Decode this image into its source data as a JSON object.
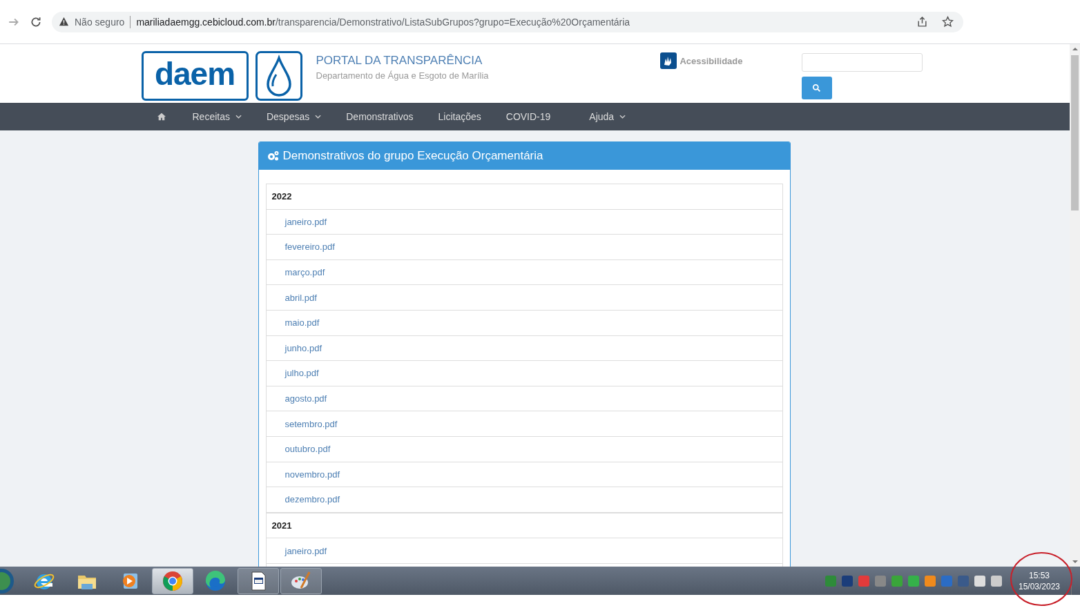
{
  "browser": {
    "security": "Não seguro",
    "url_host": "mariliadaemgg.cebicloud.com.br",
    "url_path": "/transparencia/Demonstrativo/ListaSubGrupos?grupo=Execução%20Orçamentária"
  },
  "header": {
    "logo_text": "daem",
    "title": "PORTAL DA TRANSPARÊNCIA",
    "subtitle": "Departamento de Água e Esgoto de Marília",
    "accessibility": "Acessibilidade"
  },
  "nav": [
    {
      "kind": "home"
    },
    {
      "kind": "dropdown",
      "label": "Receitas"
    },
    {
      "kind": "dropdown",
      "label": "Despesas"
    },
    {
      "kind": "link",
      "label": "Demonstrativos"
    },
    {
      "kind": "link",
      "label": "Licitações"
    },
    {
      "kind": "link",
      "label": "COVID-19"
    },
    {
      "kind": "dropdown",
      "label": "Ajuda"
    }
  ],
  "panel": {
    "title": "Demonstrativos do grupo Execução Orçamentária",
    "groups": [
      {
        "year": "2022",
        "files": [
          "janeiro.pdf",
          "fevereiro.pdf",
          "março.pdf",
          "abril.pdf",
          "maio.pdf",
          "junho.pdf",
          "julho.pdf",
          "agosto.pdf",
          "setembro.pdf",
          "outubro.pdf",
          "novembro.pdf",
          "dezembro.pdf"
        ]
      },
      {
        "year": "2021",
        "files": [
          "janeiro.pdf"
        ]
      }
    ]
  },
  "taskbar": {
    "apps": [
      {
        "kind": "ie",
        "open": false,
        "selected": false
      },
      {
        "kind": "folder",
        "open": false,
        "selected": false
      },
      {
        "kind": "media",
        "open": false,
        "selected": false
      },
      {
        "kind": "chrome",
        "open": true,
        "selected": true
      },
      {
        "kind": "edge",
        "open": false,
        "selected": false
      },
      {
        "kind": "document",
        "open": true,
        "selected": false
      },
      {
        "kind": "paint",
        "open": true,
        "selected": false
      }
    ],
    "time": "15:53",
    "date": "15/03/2023"
  }
}
